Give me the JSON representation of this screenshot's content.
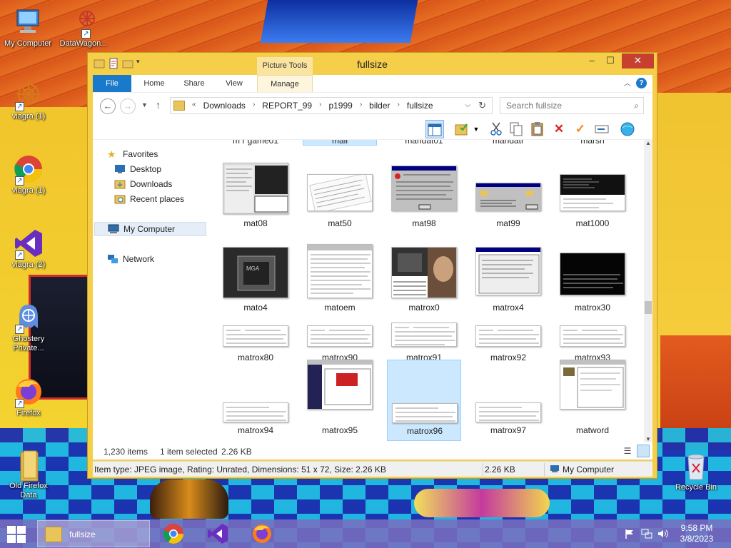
{
  "desktop": {
    "icons": [
      {
        "label": "My Computer",
        "icon": "computer-icon"
      },
      {
        "label": "DataWagon...",
        "icon": "datawagon-icon"
      },
      {
        "label": "viagra (1)",
        "icon": "viagra-tor-icon"
      },
      {
        "label": "viagra (1)",
        "icon": "chrome-icon"
      },
      {
        "label": "viagra (2)",
        "icon": "visual-studio-icon"
      },
      {
        "label": "Ghostery Private...",
        "icon": "ghostery-icon"
      },
      {
        "label": "Firefox",
        "icon": "firefox-icon"
      },
      {
        "label": "Old Firefox Data",
        "icon": "folder-icon"
      },
      {
        "label": "Recycle Bin",
        "icon": "recycle-bin-icon"
      }
    ]
  },
  "window": {
    "title": "fullsize",
    "context_tab": "Picture Tools",
    "tabs": [
      "File",
      "Home",
      "Share",
      "View",
      "Manage"
    ],
    "controls": {
      "minimize": "–",
      "maximize": "☐",
      "close": "✕"
    },
    "help": "?"
  },
  "address": {
    "prefix": "«",
    "crumbs": [
      "Downloads",
      "REPORT_99",
      "p1999",
      "bilder",
      "fullsize"
    ],
    "search_placeholder": "Search fullsize"
  },
  "nav": {
    "favorites": "Favorites",
    "items": [
      "Desktop",
      "Downloads",
      "Recent places"
    ],
    "my_computer": "My Computer",
    "network": "Network"
  },
  "files": {
    "partial_top": [
      "m r game01",
      "mail",
      "mandat01",
      "mandatr",
      "marsh"
    ],
    "rows": [
      [
        "mat08",
        "mat50",
        "mat98",
        "mat99",
        "mat1000"
      ],
      [
        "mato4",
        "matoem",
        "matrox0",
        "matrox4",
        "matrox30"
      ],
      [
        "matrox80",
        "matrox90",
        "matrox91",
        "matrox92",
        "matrox93"
      ],
      [
        "matrox94",
        "matrox95",
        "matrox96",
        "matrox97",
        "matword"
      ]
    ],
    "selected": "matrox96"
  },
  "status": {
    "count": "1,230 items",
    "selection": "1 item selected",
    "size": "2.26 KB"
  },
  "infobar": {
    "details": "Item type: JPEG image, Rating: Unrated, Dimensions: 51 x 72, Size: 2.26 KB",
    "size": "2.26 KB",
    "location": "My Computer"
  },
  "taskbar": {
    "active_window": "fullsize",
    "time": "9:58 PM",
    "date": "3/8/2023"
  },
  "colors": {
    "accent": "#1979ca",
    "window_frame": "#f5cf4a",
    "selection": "#cce8ff",
    "close": "#c7402f"
  }
}
